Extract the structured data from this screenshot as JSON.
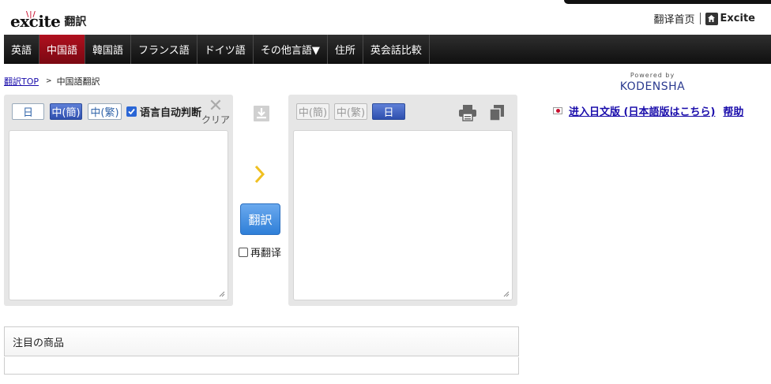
{
  "header": {
    "logo_text": "excite",
    "service_name": "翻訳",
    "links": {
      "translate_home": "翻译首页",
      "excite": "Excite"
    }
  },
  "nav": {
    "items": [
      {
        "label": "英語",
        "active": false
      },
      {
        "label": "中国語",
        "active": true
      },
      {
        "label": "韓国語",
        "active": false
      },
      {
        "label": "フランス語",
        "active": false
      },
      {
        "label": "ドイツ語",
        "active": false
      },
      {
        "label": "その他言語▼",
        "active": false
      },
      {
        "label": "住所",
        "active": false
      },
      {
        "label": "英会話比較",
        "active": false
      }
    ]
  },
  "breadcrumb": {
    "root": "翻訳TOP",
    "current": "中国語翻訳"
  },
  "source_panel": {
    "langs": [
      "日",
      "中(簡)",
      "中(繁)"
    ],
    "selected": "中(簡)",
    "auto_detect_label": "语言自动判断",
    "auto_detect_checked": true,
    "clear_label": "クリア",
    "text_value": ""
  },
  "target_panel": {
    "langs": [
      "中(簡)",
      "中(繁)",
      "日"
    ],
    "selected": "日",
    "text_value": ""
  },
  "controls": {
    "translate_label": "翻訳",
    "retranslate_label": "再翻译",
    "retranslate_checked": false
  },
  "sidebar": {
    "powered_by": "Powered by",
    "brand": "KODENSHA",
    "jp_link_label": "进入日文版 (日本語版はこちら)",
    "help_label": "帮助"
  },
  "featured": {
    "title": "注目の商品"
  },
  "colors": {
    "nav_active": "#a00d18",
    "accent_blue": "#2e4fae",
    "translate_button": "#3b87dd"
  }
}
